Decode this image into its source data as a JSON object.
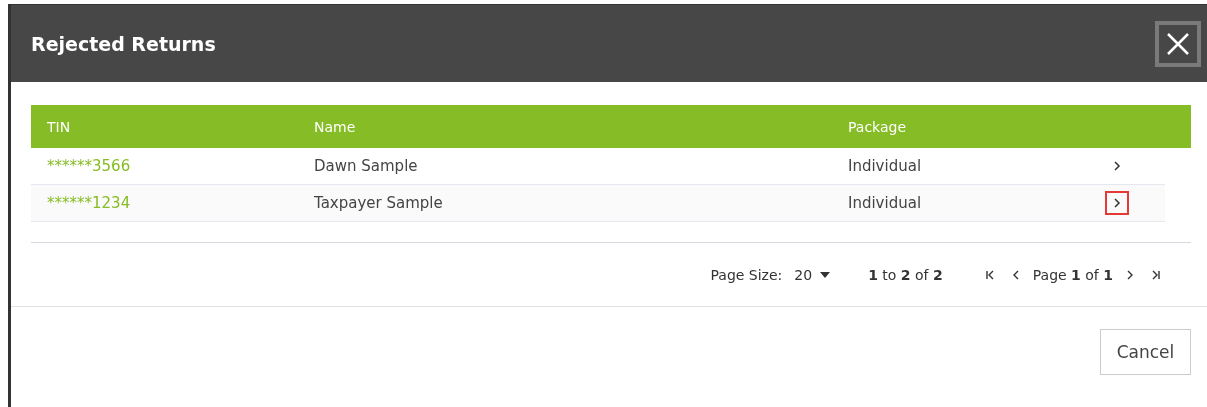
{
  "dialog": {
    "title": "Rejected Returns"
  },
  "table": {
    "columns": [
      "TIN",
      "Name",
      "Package"
    ],
    "rows": [
      {
        "tin": "******3566",
        "name": "Dawn Sample",
        "package": "Individual",
        "highlighted": false
      },
      {
        "tin": "******1234",
        "name": "Taxpayer Sample",
        "package": "Individual",
        "highlighted": true
      }
    ]
  },
  "pagination": {
    "page_size_label": "Page Size:",
    "page_size": "20",
    "range": "**1** to **2** of **2**",
    "page": "Page **1** of **1**"
  },
  "buttons": [
    "Cancel"
  ]
}
